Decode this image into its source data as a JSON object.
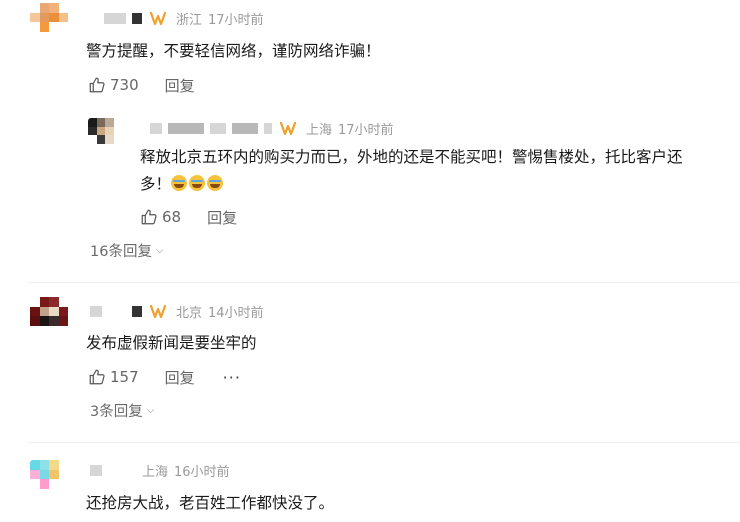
{
  "comments": [
    {
      "location": "浙江",
      "time": "17小时前",
      "text": "警方提醒，不要轻信网络，谨防网络诈骗！",
      "likes": "730",
      "reply_label": "回复",
      "avatar_colors": [
        "#ffffff",
        "#e8a775",
        "#f0b27a",
        "#ffffff",
        "#f4c79a",
        "#e39a5c",
        "#ea8e3b",
        "#f3c08a",
        "#ffffff",
        "#f39a3b",
        "#ffffff",
        "#ffffff",
        "#ffffff",
        "#ffffff",
        "#ffffff",
        "#ffffff"
      ],
      "sub_reply": {
        "location": "上海",
        "time": "17小时前",
        "text_line1": "释放北京五环内的购买力而已，外地的还是不能买吧！警惕售楼处，托比客户还",
        "text_line2": "多！",
        "likes": "68",
        "reply_label": "回复",
        "avatar_colors": [
          "#1b1b1b",
          "#7a6a5a",
          "#b9a997",
          "#ffffff",
          "#2a2a2a",
          "#caa982",
          "#e8d2b6",
          "#ffffff",
          "#ffffff",
          "#3a3a3a",
          "#e6d9c9",
          "#ffffff",
          "#ffffff",
          "#ffffff",
          "#ffffff",
          "#ffffff"
        ]
      },
      "expand_label": "16条回复"
    },
    {
      "location": "北京",
      "time": "14小时前",
      "text": "发布虚假新闻是要坐牢的",
      "likes": "157",
      "reply_label": "回复",
      "more_label": "···",
      "expand_label": "3条回复",
      "avatar_colors": [
        "#ffffff",
        "#7a1818",
        "#8b2a2a",
        "#ffffff",
        "#6a1212",
        "#c2a28a",
        "#e8d8c4",
        "#7a1a1a",
        "#5a0e0e",
        "#1b1414",
        "#3a2a2a",
        "#6a1616",
        "#ffffff",
        "#ffffff",
        "#ffffff",
        "#ffffff"
      ]
    },
    {
      "location": "上海",
      "time": "16小时前",
      "text": "还抢房大战，老百姓工作都快没了。",
      "avatar_colors": [
        "#66d8e6",
        "#8fe1e8",
        "#f5d98a",
        "#ffffff",
        "#ffb0d8",
        "#7ad9e6",
        "#f2c46a",
        "#ffffff",
        "#ffffff",
        "#ff9bcf",
        "#ffffff",
        "#ffffff",
        "#ffffff",
        "#ffffff",
        "#ffffff",
        "#ffffff"
      ]
    }
  ]
}
